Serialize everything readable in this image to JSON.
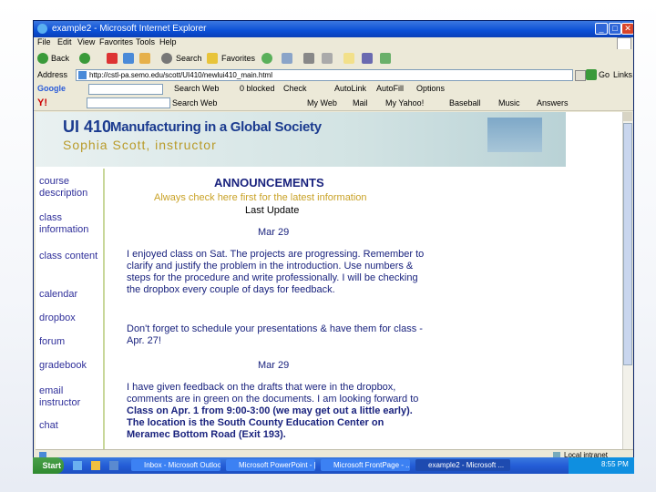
{
  "window": {
    "title": "example2 - Microsoft Internet Explorer"
  },
  "menu": [
    "File",
    "Edit",
    "View",
    "Favorites",
    "Tools",
    "Help"
  ],
  "toolbar": {
    "back": "Back",
    "search": "Search",
    "favorites": "Favorites"
  },
  "address": {
    "label": "Address",
    "url": "http://cstl-pa.semo.edu/scott/UI410/newlui410_main.html",
    "go": "Go",
    "links": "Links"
  },
  "google_bar": {
    "brand": "Google",
    "search_web": "Search Web",
    "checked": "0 blocked",
    "check": "Check",
    "autolink": "AutoLink",
    "autofill": "AutoFill",
    "options": "Options"
  },
  "yahoo_bar": {
    "my_web": "My Web",
    "mail": "Mail",
    "my_yahoo": "My Yahoo!",
    "baseball": "Baseball",
    "music": "Music",
    "answers": "Answers"
  },
  "banner": {
    "course_num": "UI 410",
    "course_title": "Manufacturing in a Global Society",
    "instructor": "Sophia Scott, instructor"
  },
  "nav": [
    "course description",
    "class information",
    "class content",
    "calendar",
    "dropbox",
    "forum",
    "gradebook",
    "email instructor",
    "chat"
  ],
  "announcements": {
    "heading": "ANNOUNCEMENTS",
    "subheading": "Always check here first for the latest information",
    "last_update": "Last Update",
    "date1": "Mar 29",
    "p1": "I enjoyed class on Sat. The projects are progressing. Remember to clarify and justify the problem in the introduction. Use numbers & steps for the procedure and write professionally. I will be checking the dropbox every couple of days for feedback.",
    "p2": "Don't forget to schedule your presentations & have them for class - Apr. 27!",
    "date2": "Mar 29",
    "p3_normal": "I have given feedback on the drafts that were in the dropbox, comments are in green on the documents. I am looking forward to ",
    "p3_bold": "Class on Apr. 1 from 9:00-3:00 (we may get out a little early). The location is the South County Education Center on Meramec Bottom Road (Exit 193)."
  },
  "status": {
    "zone": "Local intranet"
  },
  "taskbar": {
    "start": "Start",
    "tasks": [
      "Inbox - Microsoft Outlook",
      "Microsoft PowerPoint - [...",
      "Microsoft FrontPage - ...",
      "example2 - Microsoft ..."
    ],
    "clock": "8:55 PM"
  },
  "colors": {
    "title_blue": "#0b4fd6",
    "heading_blue": "#1a237e",
    "subheading_gold": "#c9a227",
    "nav_blue": "#2f2f9a",
    "bold_text": "#1a237e"
  }
}
